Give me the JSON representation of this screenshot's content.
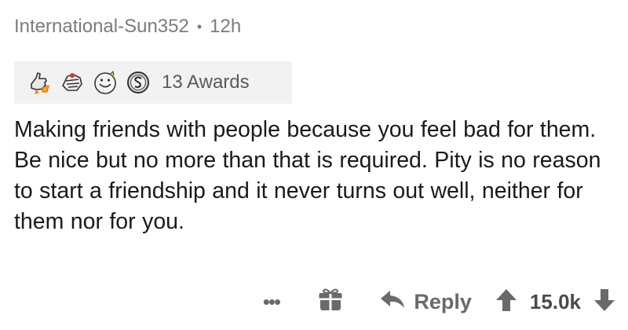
{
  "comment": {
    "author": "International-Sun352",
    "separator": "•",
    "age": "12h",
    "awards": {
      "icons": [
        "thumbs-up-award-icon",
        "hugs-award-icon",
        "wholesome-award-icon",
        "silver-coin-award-icon"
      ],
      "count_label": "13 Awards"
    },
    "body": "Making friends with people because you feel bad for them. Be nice but no more than that is required. Pity is no reason to start a friendship and it never turns out well, neither for them nor for you."
  },
  "actions": {
    "more_label": "•••",
    "reply_label": "Reply",
    "score": "15.0k"
  },
  "colors": {
    "meta_text": "#7c7c7c",
    "awards_bg": "#f2f2f2",
    "action_grey": "#6a6a6a"
  }
}
